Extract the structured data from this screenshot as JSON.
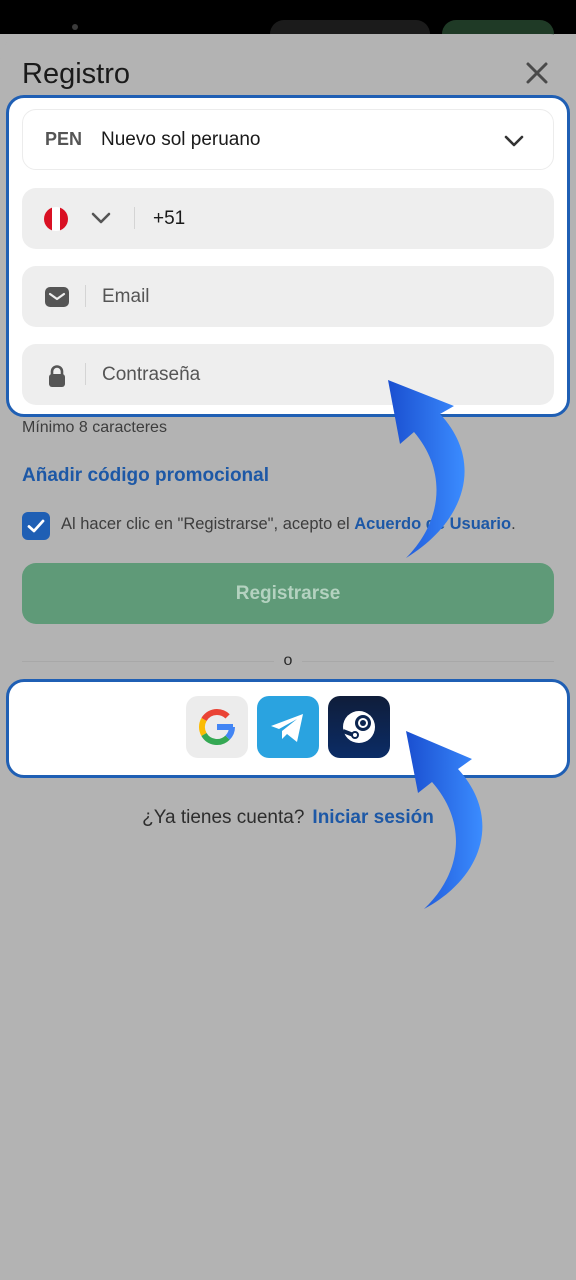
{
  "dialog": {
    "title": "Registro"
  },
  "form": {
    "currency": {
      "code": "PEN",
      "name": "Nuevo sol peruano"
    },
    "phone": {
      "country_code": "+51",
      "country": "Peru"
    },
    "email": {
      "placeholder": "Email"
    },
    "password": {
      "placeholder": "Contraseña",
      "hint": "Mínimo 8 caracteres"
    },
    "promo_link": "Añadir código promocional",
    "terms": {
      "text": "Al hacer clic en \"Registrarse\", acepto el ",
      "link": "Acuerdo de Usuario",
      "suffix": ".",
      "checked": true
    },
    "submit_label": "Registrarse"
  },
  "divider_label": "o",
  "social_login": [
    {
      "name": "google-icon"
    },
    {
      "name": "telegram-icon"
    },
    {
      "name": "steam-icon"
    }
  ],
  "footer": {
    "question": "¿Ya tienes cuenta?",
    "login_link": "Iniciar sesión"
  },
  "colors": {
    "accent": "#1d58a6",
    "submit_disabled": "#5f9a78",
    "overlay": "#b3b3b3",
    "annotation_arrow": "#1f63e6"
  }
}
